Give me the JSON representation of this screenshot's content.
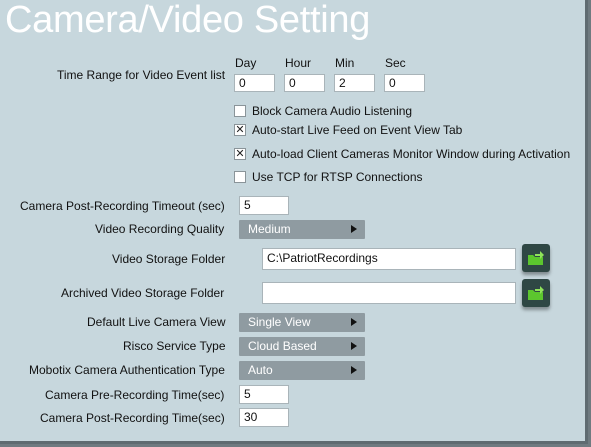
{
  "title": "Camera/Video Setting",
  "time_range": {
    "label": "Time Range for Video Event list",
    "headers": [
      "Day",
      "Hour",
      "Min",
      "Sec"
    ],
    "values": [
      "0",
      "0",
      "2",
      "0"
    ]
  },
  "checkboxes": [
    {
      "label": "Block Camera Audio Listening",
      "checked": false,
      "mark": ""
    },
    {
      "label": "Auto-start Live Feed on Event View Tab",
      "checked": true,
      "mark": "✕"
    },
    {
      "label": "Auto-load Client Cameras Monitor Window during Activation",
      "checked": true,
      "mark": "✕"
    },
    {
      "label": "Use TCP for RTSP Connections",
      "checked": false,
      "mark": ""
    }
  ],
  "post_rec_timeout": {
    "label": "Camera Post-Recording Timeout (sec)",
    "value": "5"
  },
  "recording_quality": {
    "label": "Video Recording Quality",
    "value": "Medium"
  },
  "storage_folder": {
    "label": "Video Storage Folder",
    "value": "C:\\PatriotRecordings"
  },
  "archive_folder": {
    "label": "Archived Video Storage Folder",
    "value": ""
  },
  "live_view": {
    "label": "Default Live Camera View",
    "value": "Single View"
  },
  "risco_type": {
    "label": "Risco Service Type",
    "value": "Cloud Based"
  },
  "mobotix_auth": {
    "label": "Mobotix Camera Authentication Type",
    "value": "Auto"
  },
  "pre_rec_time": {
    "label": "Camera Pre-Recording Time(sec)",
    "value": "5"
  },
  "post_rec_time": {
    "label": "Camera Post-Recording Time(sec)",
    "value": "30"
  },
  "colors": {
    "panel": "#c7d7dd",
    "dropdown": "#8f9ba1",
    "folder_button": "#2f4744",
    "folder_icon": "#5cc62e"
  }
}
